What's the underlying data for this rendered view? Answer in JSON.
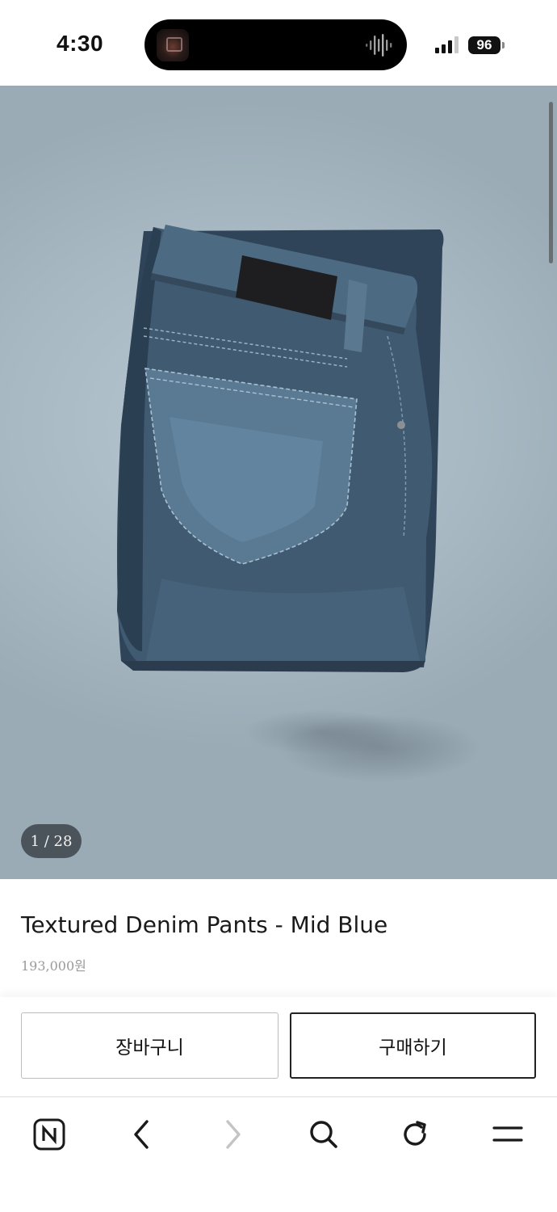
{
  "status_bar": {
    "time": "4:30",
    "battery": "96",
    "now_playing_icon": "album-art-icon",
    "waveform_icon": "waveform-icon",
    "signal_icon": "cellular-signal-icon"
  },
  "product": {
    "image_counter": "1 / 28",
    "title": "Textured Denim Pants - Mid Blue",
    "price": "193,000원"
  },
  "actions": {
    "cart_label": "장바구니",
    "buy_label": "구매하기"
  },
  "browser_toolbar": {
    "items": [
      {
        "icon": "naver-home-icon"
      },
      {
        "icon": "back-arrow-icon"
      },
      {
        "icon": "forward-arrow-icon",
        "enabled": false
      },
      {
        "icon": "search-icon"
      },
      {
        "icon": "reload-icon"
      },
      {
        "icon": "menu-icon"
      }
    ]
  },
  "colors": {
    "accent_text": "#1a1a1a",
    "price_text": "#9a9a9a",
    "buy_border": "#222222"
  }
}
